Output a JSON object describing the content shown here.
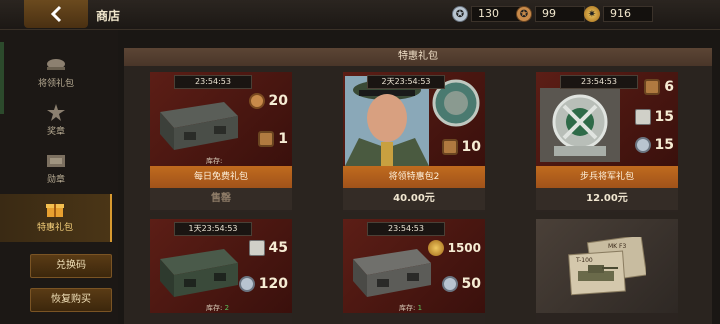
{
  "header": {
    "title": "商店",
    "currencies": [
      {
        "icon": "silver-medal-icon",
        "value": "130",
        "color": "#b8c4d0"
      },
      {
        "icon": "bronze-medal-icon",
        "value": "99",
        "color": "#c88a4a"
      },
      {
        "icon": "gold-star-medal-icon",
        "value": "916",
        "color": "#e0b048"
      }
    ]
  },
  "sidebar": {
    "items": [
      {
        "label": "将领礼包",
        "icon": "general-hat-icon",
        "active": false
      },
      {
        "label": "奖章",
        "icon": "medal-icon",
        "active": false
      },
      {
        "label": "勋章",
        "icon": "badge-icon",
        "active": false
      },
      {
        "label": "特惠礼包",
        "icon": "gift-icon",
        "active": true
      }
    ],
    "buttons": [
      {
        "label": "兑换码"
      },
      {
        "label": "恢复购买"
      }
    ]
  },
  "panel": {
    "title": "特惠礼包",
    "cards": [
      {
        "timer": "23:54:53",
        "name": "每日免费礼包",
        "price": "售罄",
        "sold": true,
        "stock_label": "库存:",
        "stock": "",
        "rewards": [
          {
            "icon": "bronze-medal-icon",
            "value": "20"
          },
          {
            "icon": "bronze-badge-icon",
            "value": "1"
          }
        ]
      },
      {
        "timer": "2天23:54:53",
        "name": "将领特惠包2",
        "price": "40.00元",
        "sold": false,
        "stock_label": "",
        "stock": "",
        "rewards": [
          {
            "icon": "bronze-badge-icon",
            "value": "10"
          }
        ]
      },
      {
        "timer": "23:54:53",
        "name": "步兵将军礼包",
        "price": "12.00元",
        "sold": false,
        "stock_label": "",
        "stock": "",
        "rewards": [
          {
            "icon": "bronze-badge-icon",
            "value": "6"
          },
          {
            "icon": "infantry-card-icon",
            "value": "15"
          },
          {
            "icon": "silver-medal-icon",
            "value": "15"
          }
        ]
      },
      {
        "timer": "1天23:54:53",
        "name": "",
        "price": "",
        "sold": false,
        "stock_label": "库存:",
        "stock": "2",
        "rewards": [
          {
            "icon": "unit-card-icon",
            "value": "45"
          },
          {
            "icon": "silver-medal-icon",
            "value": "120"
          }
        ]
      },
      {
        "timer": "23:54:53",
        "name": "",
        "price": "",
        "sold": false,
        "stock_label": "库存:",
        "stock": "1",
        "rewards": [
          {
            "icon": "gold-star-medal-icon",
            "value": "1500"
          },
          {
            "icon": "silver-medal-icon",
            "value": "50"
          }
        ]
      },
      {
        "timer": "",
        "name": "",
        "price": "",
        "sold": false,
        "stock_label": "",
        "stock": "",
        "rewards": [],
        "tank_labels": [
          "MK F3",
          "T-100"
        ]
      }
    ]
  }
}
